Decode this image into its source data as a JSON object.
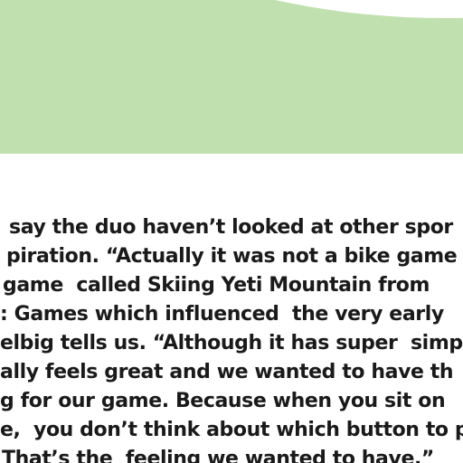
{
  "article": {
    "lines": [
      "say the duo haven’t looked at other spor",
      "piration. “Actually it was not a bike game",
      "game  called Skiing Yeti Mountain from",
      ": Games which influenced  the very early",
      "elbig tells us. “Although it has super  simp",
      "ally feels great and we wanted to have th",
      "g for our game. Because when you sit on ",
      "e,  you don’t think about which button to p",
      "That’s the  feeling we wanted to have.”"
    ]
  },
  "colors": {
    "panel_green": "#c1e0b0",
    "text": "#1a1a1a",
    "background": "#ffffff"
  }
}
